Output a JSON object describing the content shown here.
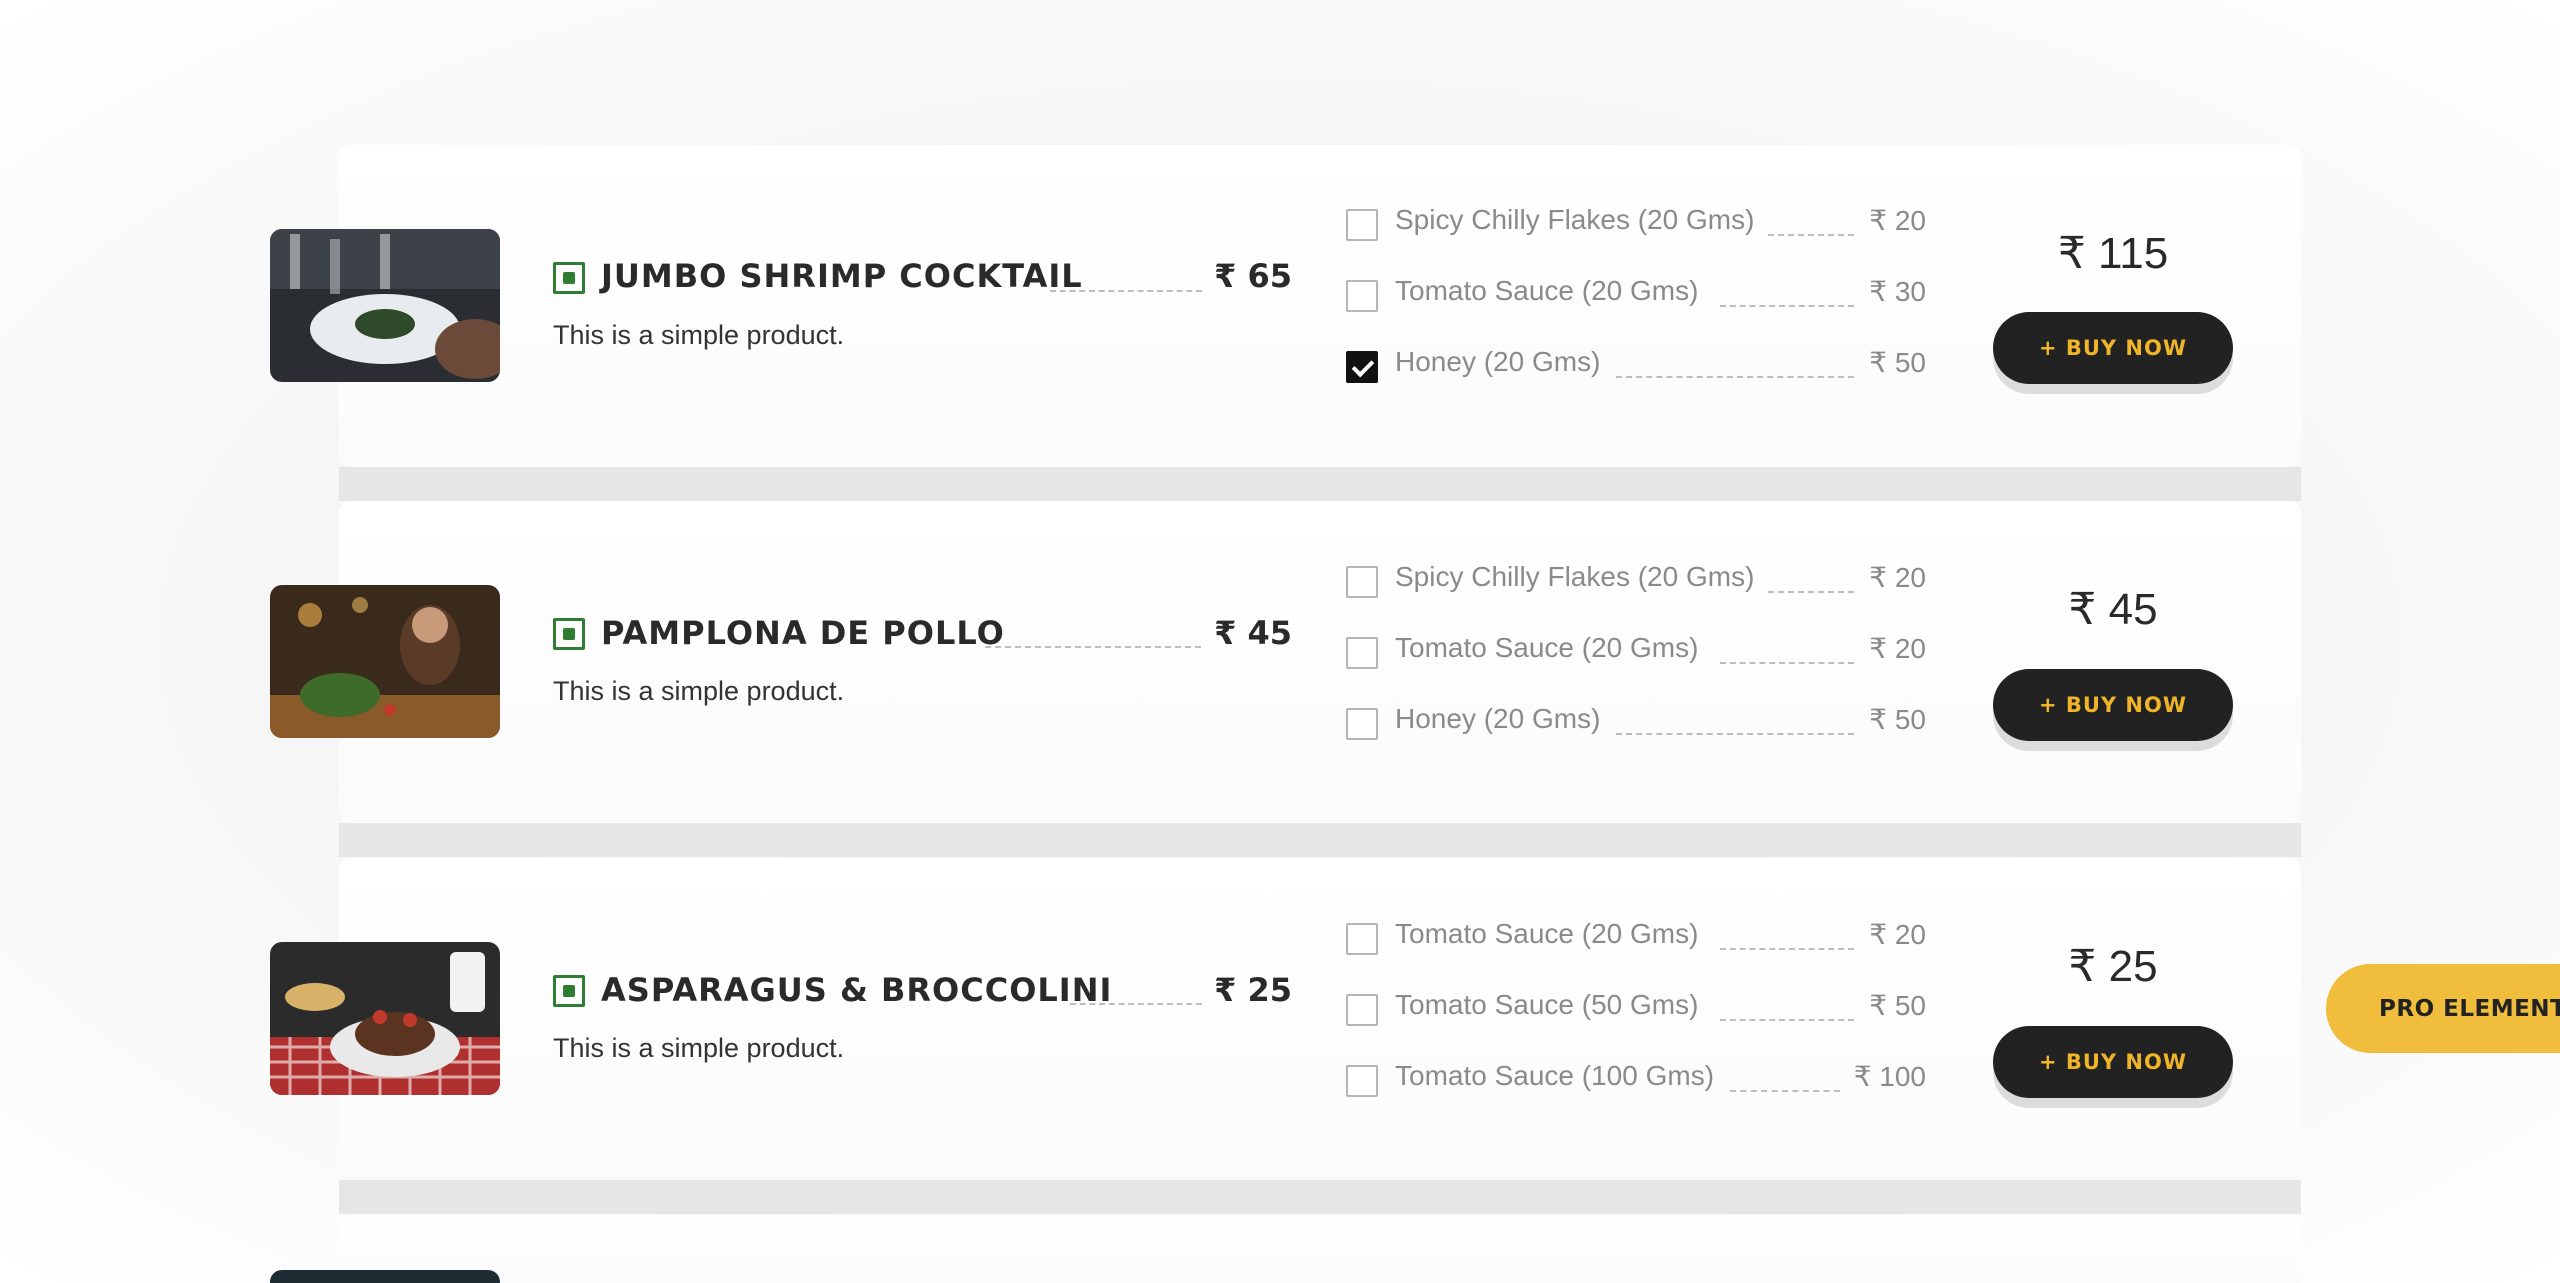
{
  "products": [
    {
      "name": "JUMBO SHRIMP COCKTAIL",
      "price": "₹ 65",
      "description": "This is a simple product.",
      "total": "₹ 115",
      "buy_label": "+ BUY NOW",
      "addons": [
        {
          "label": "Spicy Chilly Flakes (20 Gms)",
          "price": "₹ 20",
          "checked": false
        },
        {
          "label": "Tomato Sauce (20 Gms)",
          "price": "₹ 30",
          "checked": false
        },
        {
          "label": "Honey (20 Gms)",
          "price": "₹ 50",
          "checked": true
        }
      ]
    },
    {
      "name": "PAMPLONA DE POLLO",
      "price": "₹ 45",
      "description": "This is a simple product.",
      "total": "₹ 45",
      "buy_label": "+ BUY NOW",
      "addons": [
        {
          "label": "Spicy Chilly Flakes (20 Gms)",
          "price": "₹ 20",
          "checked": false
        },
        {
          "label": "Tomato Sauce (20 Gms)",
          "price": "₹ 20",
          "checked": false
        },
        {
          "label": "Honey (20 Gms)",
          "price": "₹ 50",
          "checked": false
        }
      ]
    },
    {
      "name": "ASPARAGUS & BROCCOLINI",
      "price": "₹ 25",
      "description": "This is a simple product.",
      "total": "₹ 25",
      "buy_label": "+ BUY NOW",
      "addons": [
        {
          "label": "Tomato Sauce (20 Gms)",
          "price": "₹ 20",
          "checked": false
        },
        {
          "label": "Tomato Sauce (50 Gms)",
          "price": "₹ 50",
          "checked": false
        },
        {
          "label": "Tomato Sauce (100 Gms)",
          "price": "₹ 100",
          "checked": false
        }
      ]
    }
  ],
  "pro_badge": "PRO ELEMENT",
  "colors": {
    "accent": "#f0b429",
    "button_bg": "#222222",
    "veg_green": "#2e7d32",
    "pro_badge_bg": "#f0bd3c"
  }
}
